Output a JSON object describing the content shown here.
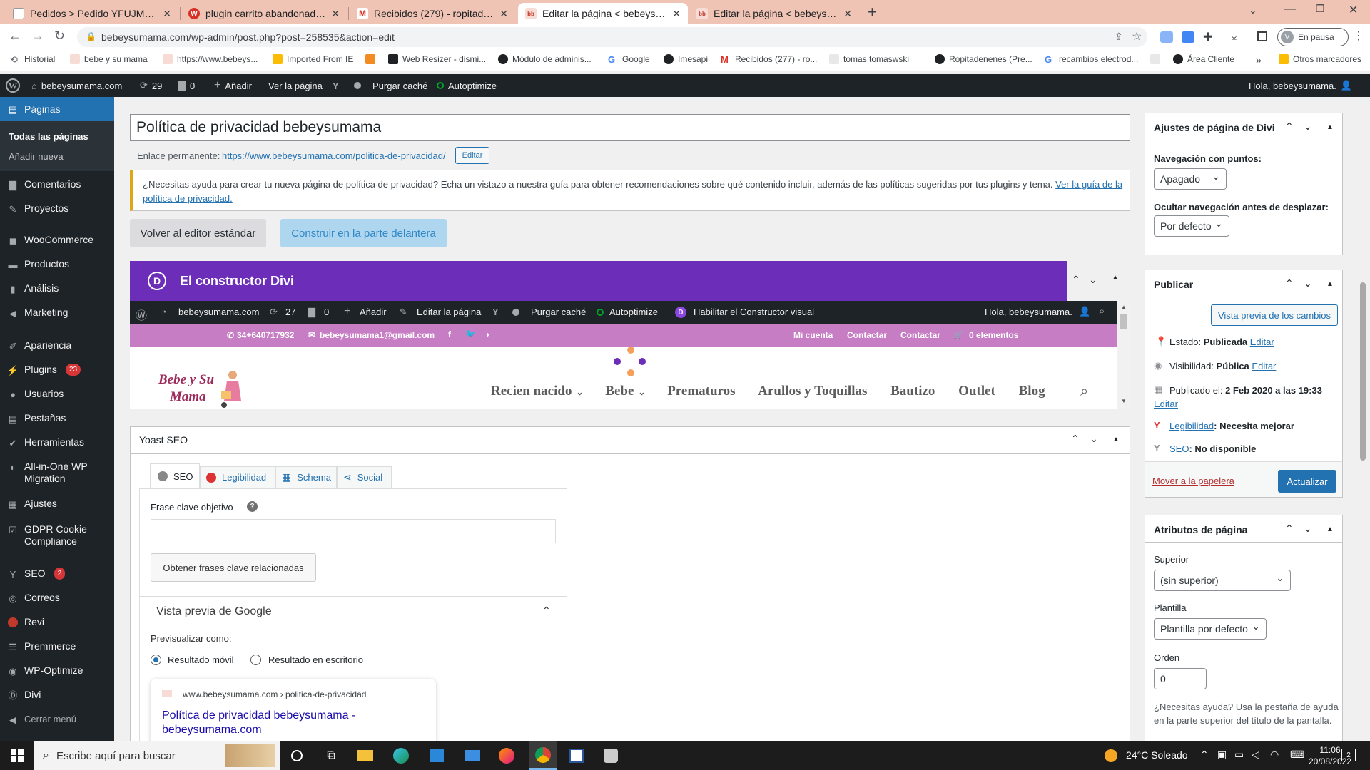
{
  "browser": {
    "tabs": [
      {
        "title": "Pedidos > Pedido YFUJMTZWY d",
        "color": "#fff"
      },
      {
        "title": "plugin carrito abandonado que f",
        "color": "#d93025"
      },
      {
        "title": "Recibidos (279) - ropitadenenes",
        "color": "#fff"
      },
      {
        "title": "Editar la página < bebeysumama",
        "color": "#fff"
      },
      {
        "title": "Editar la página < bebeysumama",
        "color": "#fff"
      }
    ],
    "url": "bebeysumama.com/wp-admin/post.php?post=258535&action=edit",
    "profile_status": "En pausa",
    "profile_initial": "V",
    "bookmarks": [
      "Historial",
      "bebe y su mama",
      "https://www.bebeys...",
      "Imported From IE",
      "Web Resizer - dismi...",
      "Módulo de adminis...",
      "Google",
      "Imesapi",
      "Recibidos (277) - ro...",
      "tomas tomaswski",
      "Ropitadenenes (Pre...",
      "recambios electrod...",
      "Área Cliente"
    ],
    "bookmarks_more": "»",
    "other_bookmarks": "Otros marcadores"
  },
  "adminbar": {
    "site": "bebeysumama.com",
    "updates": "29",
    "comments": "0",
    "add": "Añadir",
    "view": "Ver la página",
    "purge": "Purgar caché",
    "autoptimize": "Autoptimize",
    "greeting": "Hola, bebeysumama."
  },
  "sidebar": {
    "current": "Páginas",
    "sub": [
      "Todas las páginas",
      "Añadir nueva"
    ],
    "items": [
      {
        "label": "Comentarios"
      },
      {
        "label": "Proyectos"
      },
      {
        "label": "WooCommerce"
      },
      {
        "label": "Productos"
      },
      {
        "label": "Análisis"
      },
      {
        "label": "Marketing"
      },
      {
        "label": "Apariencia"
      },
      {
        "label": "Plugins",
        "badge": "23"
      },
      {
        "label": "Usuarios"
      },
      {
        "label": "Pestañas"
      },
      {
        "label": "Herramientas"
      },
      {
        "label": "All-in-One WP Migration"
      },
      {
        "label": "Ajustes"
      },
      {
        "label": "GDPR Cookie Compliance"
      },
      {
        "label": "SEO",
        "badge": "2"
      },
      {
        "label": "Correos"
      },
      {
        "label": "Revi"
      },
      {
        "label": "Premmerce"
      },
      {
        "label": "WP-Optimize"
      },
      {
        "label": "Divi"
      },
      {
        "label": "Cerrar menú"
      }
    ]
  },
  "editor": {
    "title": "Política de privacidad bebeysumama",
    "permalink_label": "Enlace permanente:",
    "permalink_url": "https://www.bebeysumama.com/politica-de-privacidad/",
    "edit_btn": "Editar",
    "notice_text": "¿Necesitas ayuda para crear tu nueva página de política de privacidad? Echa un vistazo a nuestra guía para obtener recomendaciones sobre qué contenido incluir, además de las políticas sugeridas por tus plugins y tema.",
    "notice_link_1": "Ver la guía de la",
    "notice_link_2": "política de privacidad.",
    "back_btn": "Volver al editor estándar",
    "front_btn": "Construir en la parte delantera"
  },
  "divi": {
    "logo": "D",
    "title": "El constructor Divi",
    "preview_bar": {
      "site": "bebeysumama.com",
      "updates": "27",
      "comments": "0",
      "add": "Añadir",
      "edit": "Editar la página",
      "purge": "Purgar caché",
      "autoptimize": "Autoptimize",
      "visual": "Habilitar el Constructor visual",
      "greeting": "Hola, bebeysumama."
    },
    "topbar": {
      "phone": "34+640717932",
      "email": "bebeysumama1@gmail.com",
      "links": [
        "Mi cuenta",
        "Contactar",
        "Contactar",
        "0 elementos"
      ]
    },
    "logo_text_1": "Bebe y Su",
    "logo_text_2": "Mama",
    "nav": [
      "Recien nacido",
      "Bebe",
      "Prematuros",
      "Arullos y Toquillas",
      "Bautizo",
      "Outlet",
      "Blog"
    ]
  },
  "yoast": {
    "title": "Yoast SEO",
    "tabs": [
      "SEO",
      "Legibilidad",
      "Schema",
      "Social"
    ],
    "keyphrase_label": "Frase clave objetivo",
    "related_btn": "Obtener frases clave relacionadas",
    "google_preview": "Vista previa de Google",
    "preview_as": "Previsualizar como:",
    "radio_mobile": "Resultado móvil",
    "radio_desktop": "Resultado en escritorio",
    "snippet_url": "www.bebeysumama.com › politica-de-privacidad",
    "snippet_title_1": "Política de privacidad bebeysumama -",
    "snippet_title_2": "bebeysumama.com"
  },
  "divi_settings": {
    "title": "Ajustes de página de Divi",
    "dots_label": "Navegación con puntos:",
    "dots_value": "Apagado",
    "hide_label": "Ocultar navegación antes de desplazar:",
    "hide_value": "Por defecto"
  },
  "publish": {
    "title": "Publicar",
    "preview_btn": "Vista previa de los cambios",
    "status_label": "Estado:",
    "status_value": "Publicada",
    "visibility_label": "Visibilidad:",
    "visibility_value": "Pública",
    "published_label": "Publicado el:",
    "published_value": "2 Feb 2020 a las 19:33",
    "edit": "Editar",
    "readability_link": "Legibilidad",
    "readability_value": ": Necesita mejorar",
    "seo_link": "SEO",
    "seo_value": ": No disponible",
    "trash": "Mover a la papelera",
    "update_btn": "Actualizar"
  },
  "attributes": {
    "title": "Atributos de página",
    "parent_label": "Superior",
    "parent_value": "(sin superior)",
    "template_label": "Plantilla",
    "template_value": "Plantilla por defecto",
    "order_label": "Orden",
    "order_value": "0",
    "help_1": "¿Necesitas ayuda? Usa la pestaña de ayuda",
    "help_2": "en la parte superior del título de la pantalla."
  },
  "taskbar": {
    "search_placeholder": "Escribe aquí para buscar",
    "weather": "24°C Soleado",
    "time": "11:06",
    "date": "20/08/2022",
    "notifications": "2"
  },
  "colors": {
    "wp_dark": "#1d2327",
    "wp_blue": "#2271b1",
    "divi_purple": "#6c2eb9",
    "site_pink": "#c77dc4",
    "tabbar": "#f0c4b4"
  }
}
